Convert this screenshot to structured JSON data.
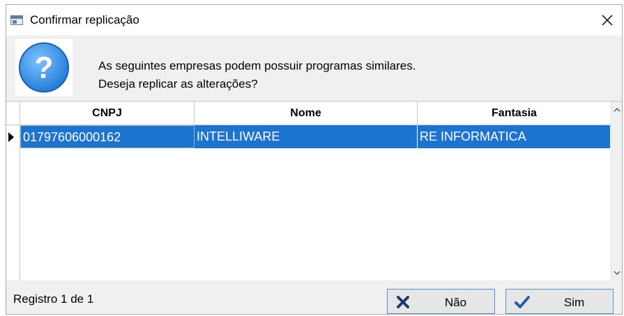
{
  "window": {
    "title": "Confirmar replicação"
  },
  "message": {
    "line1": "As seguintes empresas podem possuir programas similares.",
    "line2": "Deseja  replicar as alterações?"
  },
  "grid": {
    "columns": [
      "CNPJ",
      "Nome",
      "Fantasia"
    ],
    "rows": [
      {
        "cnpj": "01797606000162",
        "nome": "INTELLIWARE",
        "fantasia": "RE INFORMATICA",
        "selected": true
      }
    ]
  },
  "footer": {
    "status": "Registro 1 de 1",
    "no_label": "Não",
    "yes_label": "Sim"
  },
  "icons": {
    "title": "app-window-icon",
    "question": "question-icon",
    "close": "close-icon",
    "no": "x-icon",
    "yes": "checkmark-icon"
  },
  "colors": {
    "selection": "#1d73d0",
    "question_blue": "#2f8fe0",
    "no_icon": "#1a3a6e",
    "yes_icon": "#1f5fb0"
  }
}
